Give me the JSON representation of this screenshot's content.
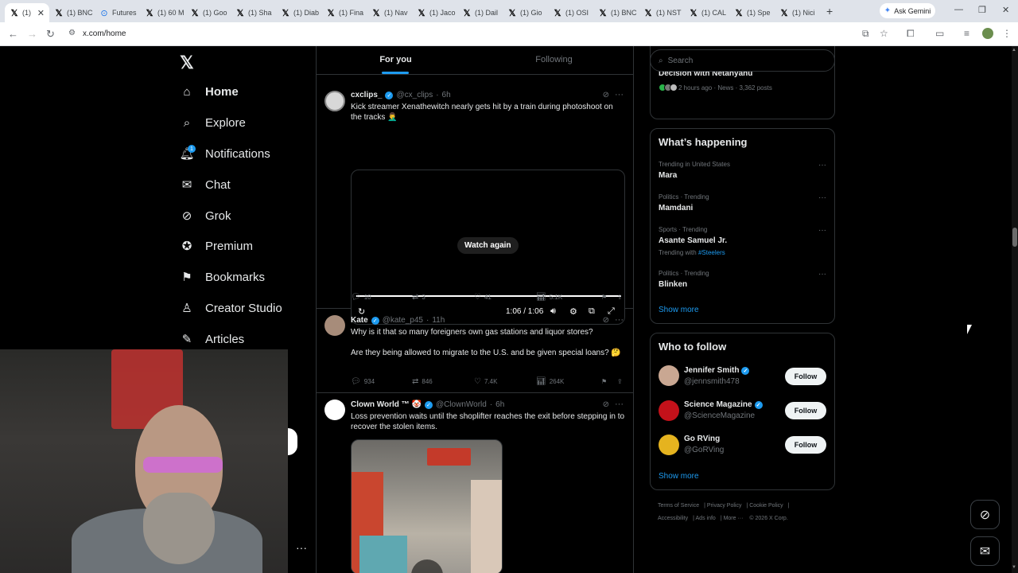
{
  "browser": {
    "tabs": [
      {
        "label": "(1)",
        "icon": "x-icon",
        "active": true
      },
      {
        "label": "(1) BNC",
        "icon": "x-icon"
      },
      {
        "label": "Futures",
        "icon": "futures-icon"
      },
      {
        "label": "(1) 60 M",
        "icon": "x-icon"
      },
      {
        "label": "(1) Goo",
        "icon": "x-icon"
      },
      {
        "label": "(1) Sha",
        "icon": "x-icon"
      },
      {
        "label": "(1) Diab",
        "icon": "x-icon"
      },
      {
        "label": "(1) Fina",
        "icon": "x-icon"
      },
      {
        "label": "(1) Nav",
        "icon": "x-icon"
      },
      {
        "label": "(1) Jaco",
        "icon": "x-icon"
      },
      {
        "label": "(1) Dail",
        "icon": "x-icon"
      },
      {
        "label": "(1) Gio",
        "icon": "x-icon"
      },
      {
        "label": "(1) OSI",
        "icon": "x-icon"
      },
      {
        "label": "(1) BNC",
        "icon": "x-icon"
      },
      {
        "label": "(1) NST",
        "icon": "x-icon"
      },
      {
        "label": "(1) CAL",
        "icon": "x-icon"
      },
      {
        "label": "(1) Spe",
        "icon": "x-icon"
      },
      {
        "label": "(1) Nici",
        "icon": "x-icon"
      }
    ],
    "gemini_label": "Ask Gemini",
    "url": "x.com/home"
  },
  "nav": {
    "items": [
      {
        "label": "Home",
        "icon": "home-icon"
      },
      {
        "label": "Explore",
        "icon": "search-icon"
      },
      {
        "label": "Notifications",
        "icon": "bell-icon"
      },
      {
        "label": "Chat",
        "icon": "mail-icon"
      },
      {
        "label": "Grok",
        "icon": "grok-icon"
      },
      {
        "label": "Premium",
        "icon": "premium-icon"
      },
      {
        "label": "Bookmarks",
        "icon": "bookmark-icon"
      },
      {
        "label": "Creator Studio",
        "icon": "creator-icon"
      },
      {
        "label": "Articles",
        "icon": "articles-icon"
      }
    ],
    "notification_badge": "1"
  },
  "feed": {
    "tabs": [
      "For you",
      "Following"
    ],
    "posts": [
      {
        "name": "cxclips_",
        "handle": "@cx_clips",
        "time": "6h",
        "text": "Kick streamer Xenathewitch nearly gets hit by a train during photoshoot on the tracks 🤦‍♂️",
        "video": {
          "watch_again": "Watch again",
          "time": "1:06 / 1:06"
        },
        "stats": {
          "replies": "10",
          "reposts": "3",
          "likes": "41",
          "views": "5.1K"
        }
      },
      {
        "name": "Kate",
        "handle": "@kate_p45",
        "time": "11h",
        "text": "Why is it that so many foreigners own gas stations and liquor stores?",
        "text2": "Are they being allowed to migrate to the U.S. and be given special loans? 🤔",
        "stats": {
          "replies": "934",
          "reposts": "846",
          "likes": "7.4K",
          "views": "264K"
        }
      },
      {
        "name": "Clown World ™ 🤡",
        "handle": "@ClownWorld",
        "time": "6h",
        "text": "Loss prevention waits until the shoplifter reaches the exit before stepping in to recover the stolen items."
      }
    ]
  },
  "sidebar": {
    "search_placeholder": "Search",
    "news": {
      "title": "Trump Says Ending Iran War Will Be Mutual Decision with Netanyahu",
      "meta": "2 hours ago · News · 3,362 posts"
    },
    "happening": {
      "title": "What’s happening",
      "trends": [
        {
          "category": "Trending in United States",
          "name": "Mara"
        },
        {
          "category": "Politics · Trending",
          "name": "Mamdani"
        },
        {
          "category": "Sports · Trending",
          "name": "Asante Samuel Jr.",
          "with_label": "Trending with",
          "with_tag": "#Steelers"
        },
        {
          "category": "Politics · Trending",
          "name": "Blinken"
        }
      ],
      "show_more": "Show more"
    },
    "who_to_follow": {
      "title": "Who to follow",
      "accounts": [
        {
          "name": "Jennifer Smith",
          "handle": "@jennsmith478",
          "button": "Follow"
        },
        {
          "name": "Science Magazine",
          "handle": "@ScienceMagazine",
          "button": "Follow"
        },
        {
          "name": "Go RVing",
          "handle": "@GoRVing",
          "button": "Follow"
        }
      ],
      "show_more": "Show more"
    },
    "footer": [
      "Terms of Service",
      "Privacy Policy",
      "Cookie Policy",
      "Accessibility",
      "Ads info",
      "More ···",
      "© 2026 X Corp."
    ]
  },
  "colors": {
    "accent": "#1d9bf0",
    "background": "#000000",
    "border": "#2f3336"
  }
}
